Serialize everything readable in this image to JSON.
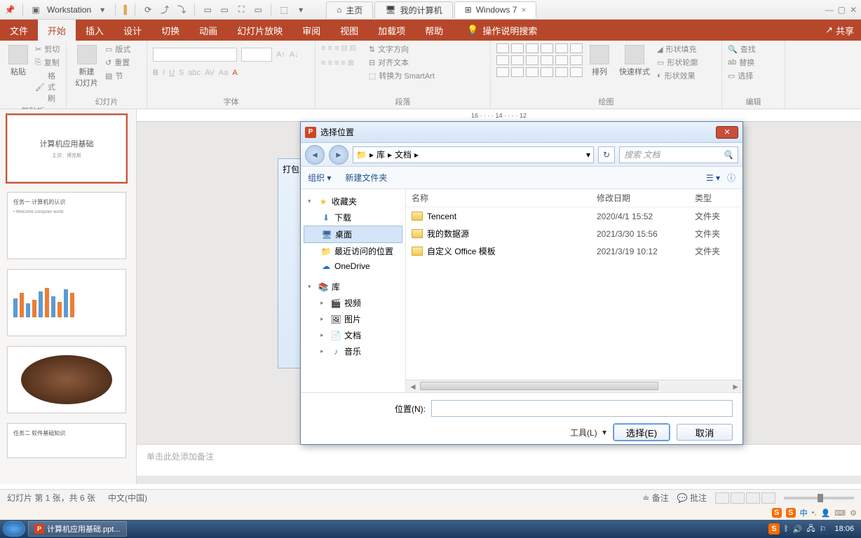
{
  "vm": {
    "workstation": "Workstation",
    "tabs": {
      "home": "主页",
      "mypc": "我的计算机",
      "win7": "Windows 7"
    }
  },
  "pp": {
    "tabs": {
      "file": "文件",
      "home": "开始",
      "insert": "插入",
      "design": "设计",
      "trans": "切换",
      "anim": "动画",
      "slideshow": "幻灯片放映",
      "review": "审阅",
      "view": "视图",
      "addons": "加载项",
      "help": "帮助"
    },
    "search_hint": "操作说明搜索",
    "share": "共享",
    "ribbon": {
      "clipboard": {
        "label": "剪贴板",
        "cut": "剪切",
        "copy": "复制",
        "paste": "粘贴",
        "format": "格式刷"
      },
      "slides": {
        "label": "幻灯片",
        "new": "新建\n幻灯片",
        "layout": "版式",
        "reset": "重置",
        "section": "节"
      },
      "font": {
        "label": "字体"
      },
      "para": {
        "label": "段落",
        "textdir": "文字方向",
        "align": "对齐文本",
        "smartart": "转换为 SmartArt"
      },
      "draw": {
        "label": "绘图",
        "arrange": "排列",
        "quick": "快速样式",
        "fill": "形状填充",
        "outline": "形状轮廓",
        "effects": "形状效果"
      },
      "edit": {
        "label": "编辑",
        "find": "查找",
        "replace": "替换",
        "select": "选择"
      }
    },
    "thumbs": {
      "t1_title": "计算机应用基础",
      "t1_sub": "主讲：博克斯",
      "t2": "任务一  计算机的认识",
      "t2_sub": "• Welcome computer world",
      "t5": "任务二  软件基础知识"
    },
    "notes_placeholder": "单击此处添加备注",
    "ruler_marks": "16 · · · · 14 · · · · 12",
    "status": {
      "slide": "幻灯片 第 1 张，共 6 张",
      "lang": "中文(中国)",
      "notes": "备注",
      "comments": "批注"
    }
  },
  "pkg_title": "打包",
  "dialog": {
    "title": "选择位置",
    "crumbs": {
      "lib": "库",
      "docs": "文档"
    },
    "search_ph": "搜索 文档",
    "refresh": "↻",
    "organize": "组织",
    "newfolder": "新建文件夹",
    "tree": {
      "fav": "收藏夹",
      "downloads": "下载",
      "desktop": "桌面",
      "recent": "最近访问的位置",
      "onedrive": "OneDrive",
      "lib": "库",
      "video": "视频",
      "pictures": "图片",
      "docs": "文档",
      "music": "音乐"
    },
    "cols": {
      "name": "名称",
      "date": "修改日期",
      "type": "类型"
    },
    "files": [
      {
        "name": "Tencent",
        "date": "2020/4/1 15:52",
        "type": "文件夹"
      },
      {
        "name": "我的数据源",
        "date": "2021/3/30 15:56",
        "type": "文件夹"
      },
      {
        "name": "自定义 Office 模板",
        "date": "2021/3/19 10:12",
        "type": "文件夹"
      }
    ],
    "loc_label": "位置(N):",
    "tools": "工具(L)",
    "select": "选择(E)",
    "cancel": "取消"
  },
  "taskbar": {
    "app": "计算机应用基础.ppt...",
    "time": "18:06"
  }
}
